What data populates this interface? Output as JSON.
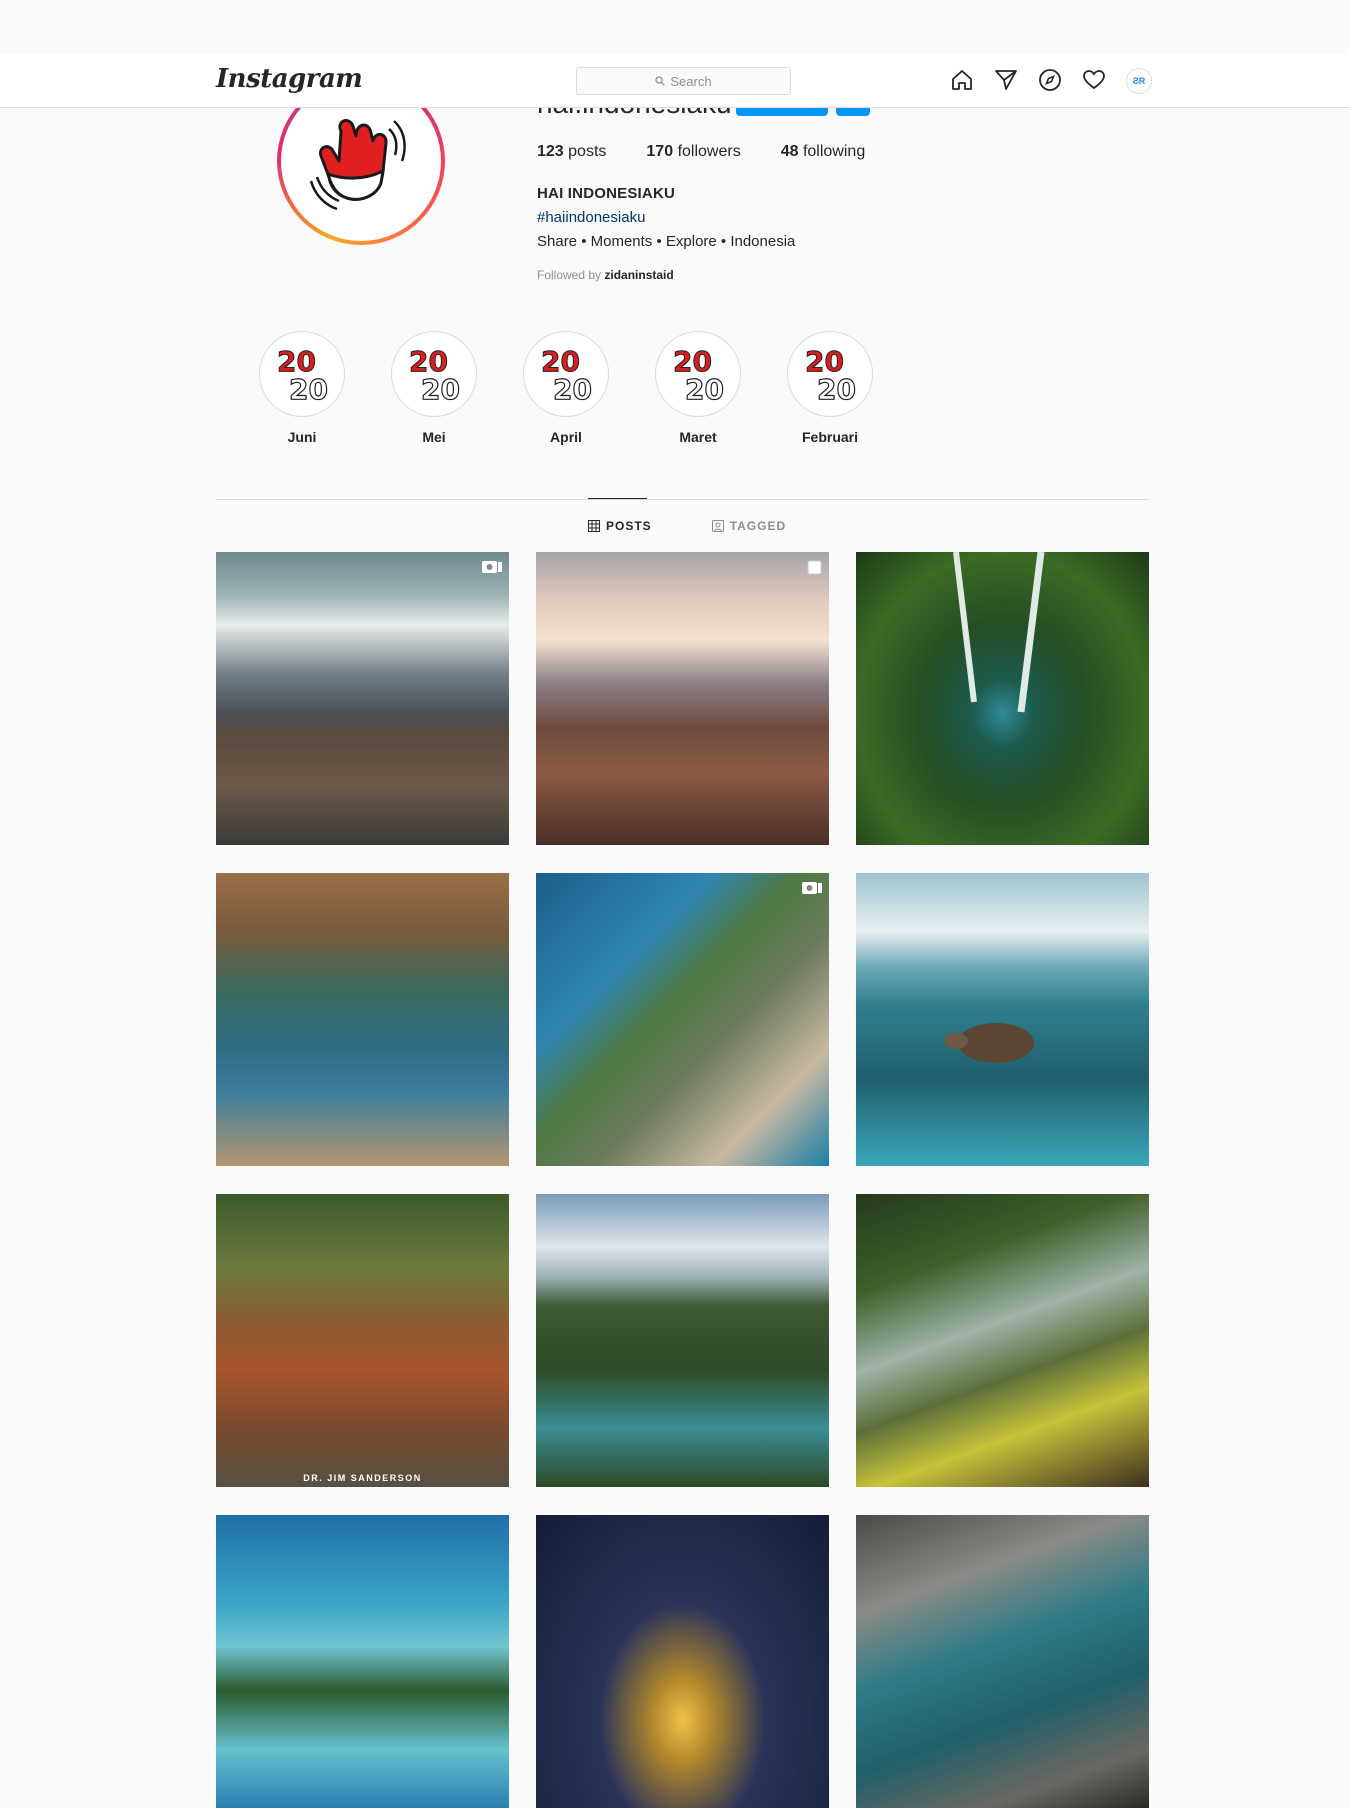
{
  "header": {
    "logo": "Instagram",
    "search_placeholder": "Search",
    "nav_icons": [
      "home-icon",
      "direct-icon",
      "explore-icon",
      "activity-icon",
      "profile-avatar"
    ],
    "avatar_initials": "ƧR"
  },
  "profile": {
    "username": "hai.indonesiaku",
    "stats": {
      "posts_count": "123",
      "posts_label": "posts",
      "followers_count": "170",
      "followers_label": "followers",
      "following_count": "48",
      "following_label": "following"
    },
    "full_name": "HAI INDONESIAKU",
    "hashtag": "#haiindonesiaku",
    "bio": "Share • Moments • Explore • Indonesia",
    "followed_by_prefix": "Followed by",
    "followed_by_user": "zidaninstaid",
    "colors": {
      "follow_button": "#0095f6",
      "link": "#00376b"
    }
  },
  "highlights": [
    {
      "label": "Juni"
    },
    {
      "label": "Mei"
    },
    {
      "label": "April"
    },
    {
      "label": "Maret"
    },
    {
      "label": "Februari"
    }
  ],
  "tabs": {
    "posts_label": "POSTS",
    "tagged_label": "TAGGED",
    "active": "POSTS"
  },
  "posts": [
    {
      "subject": "sea of clouds over crater rim",
      "badge": "video-icon"
    },
    {
      "subject": "volcano crater at sunset",
      "badge": "carousel-icon"
    },
    {
      "subject": "aerial twin waterfalls in jungle",
      "badge": ""
    },
    {
      "subject": "canyon lake with boat",
      "badge": ""
    },
    {
      "subject": "kelingking cliff coast",
      "badge": "video-icon"
    },
    {
      "subject": "sea turtle split view",
      "badge": ""
    },
    {
      "subject": "bay cat in enclosure",
      "badge": "",
      "overlay_text": "DR. JIM SANDERSON"
    },
    {
      "subject": "river through palm forest",
      "badge": ""
    },
    {
      "subject": "waterfall with yellow railing",
      "badge": ""
    },
    {
      "subject": "tropical island aerial",
      "badge": ""
    },
    {
      "subject": "golden dome mosque at night",
      "badge": ""
    },
    {
      "subject": "rocky coast with blue water",
      "badge": ""
    }
  ]
}
